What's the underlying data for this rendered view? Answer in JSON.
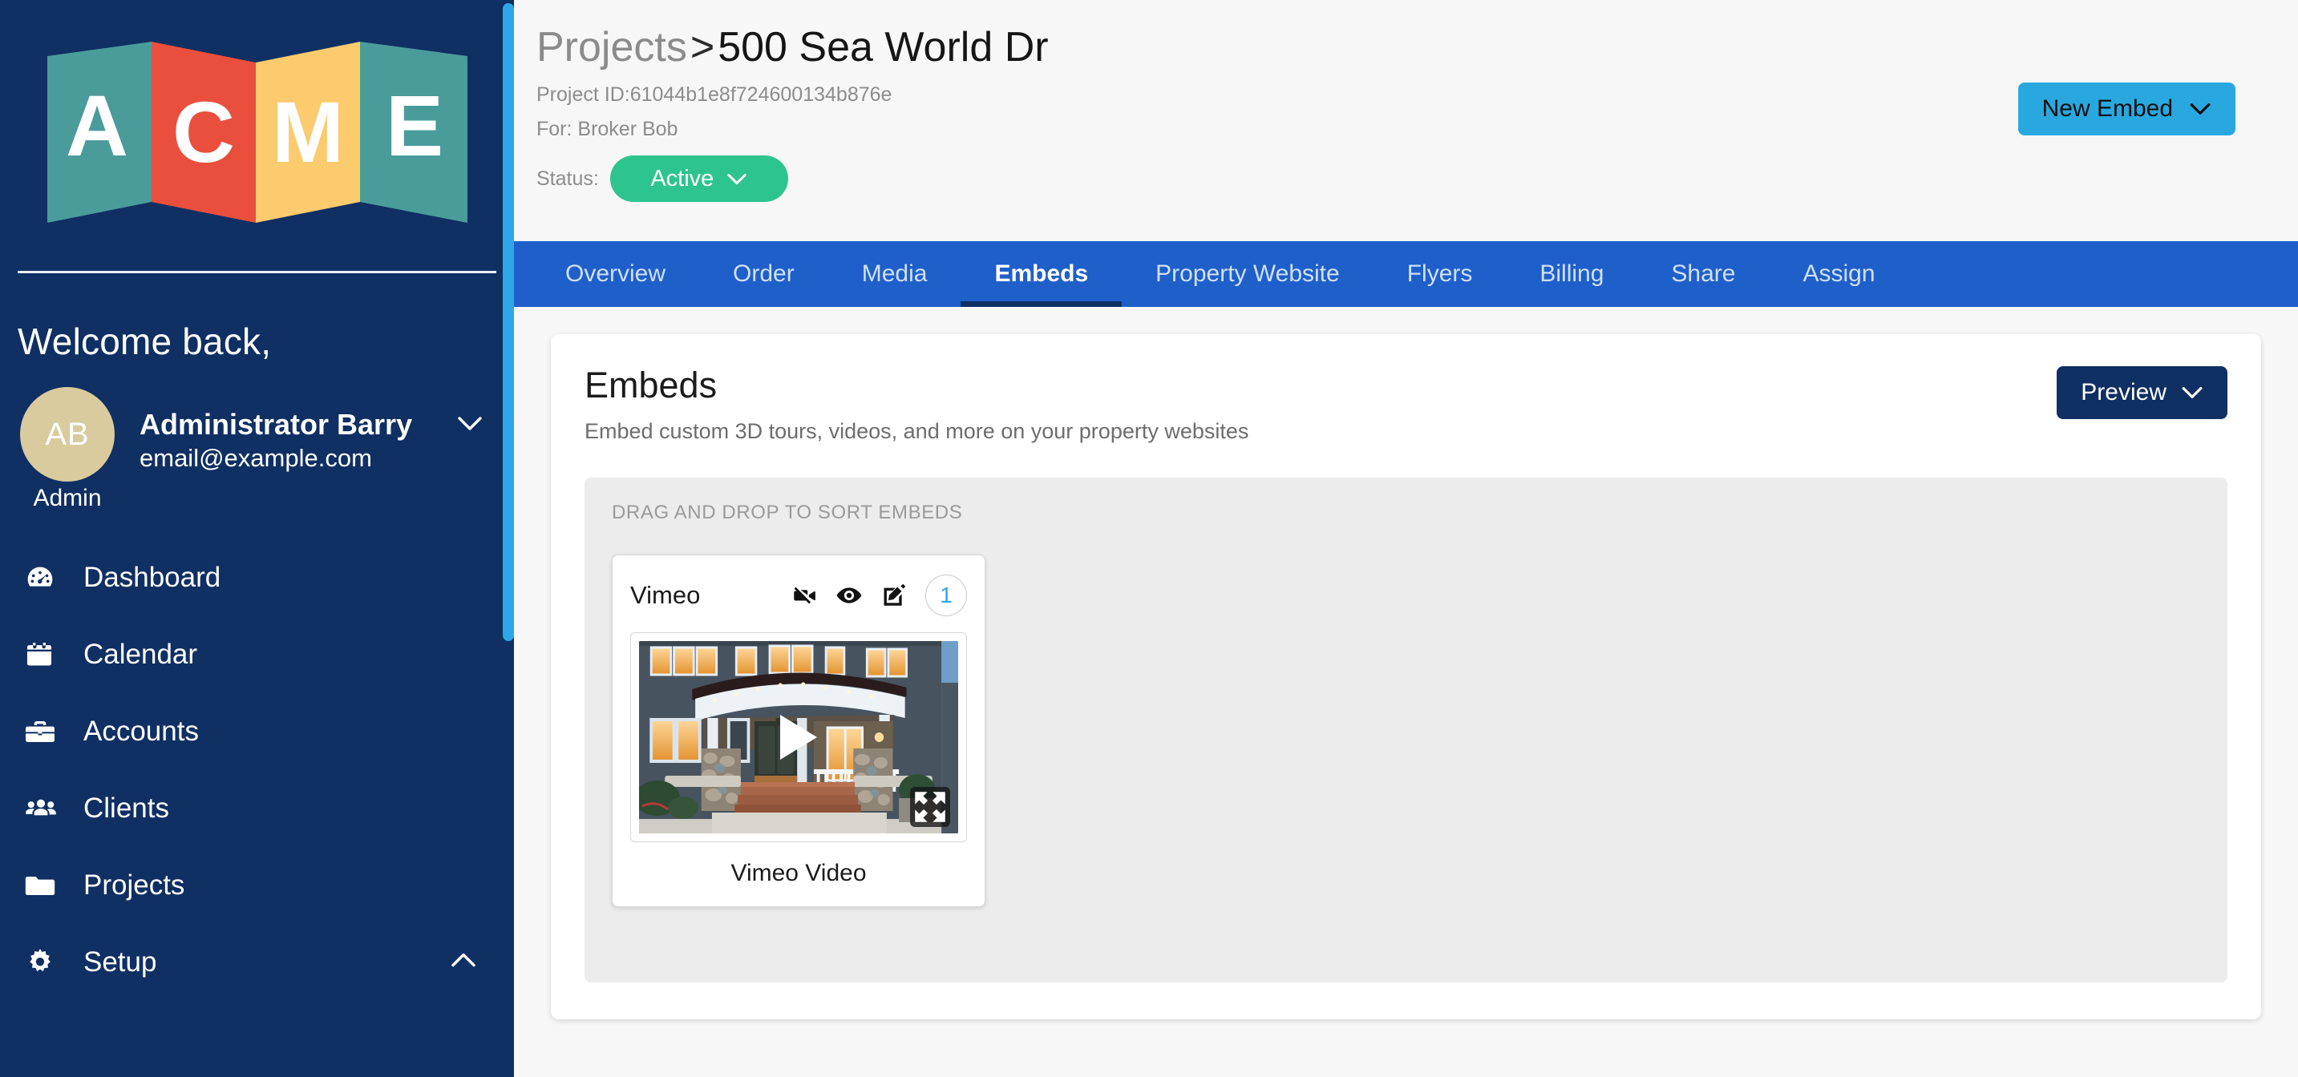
{
  "brand": {
    "logo_text": "ACME",
    "logo_letters": [
      "A",
      "C",
      "M",
      "E"
    ],
    "colors": {
      "sidebar_bg": "#102f63",
      "teal": "#4a9c9a",
      "red": "#ea4f3d",
      "yellow": "#fbcb6e",
      "accent_blue": "#29a8e0",
      "tab_blue": "#1f5fca",
      "status_green": "#2ec48f"
    }
  },
  "sidebar": {
    "welcome_text": "Welcome back,",
    "user": {
      "initials": "AB",
      "role": "Admin",
      "name": "Administrator Barry",
      "email": "email@example.com",
      "chevron": "chevron-down-icon"
    },
    "items": [
      {
        "label": "Dashboard",
        "icon": "tachometer-icon"
      },
      {
        "label": "Calendar",
        "icon": "calendar-icon"
      },
      {
        "label": "Accounts",
        "icon": "briefcase-icon"
      },
      {
        "label": "Clients",
        "icon": "users-icon"
      },
      {
        "label": "Projects",
        "icon": "folder-icon"
      },
      {
        "label": "Setup",
        "icon": "gear-icon",
        "chevron": "chevron-up-icon"
      }
    ]
  },
  "header": {
    "breadcrumb_parent": "Projects",
    "breadcrumb_separator": ">",
    "breadcrumb_current": "500 Sea World Dr",
    "project_id_line": "Project ID:61044b1e8f724600134b876e",
    "for_line": "For: Broker Bob",
    "status_label": "Status:",
    "status_value": "Active",
    "new_embed_label": "New Embed"
  },
  "tabs": [
    {
      "label": "Overview",
      "active": false
    },
    {
      "label": "Order",
      "active": false
    },
    {
      "label": "Media",
      "active": false
    },
    {
      "label": "Embeds",
      "active": true
    },
    {
      "label": "Property Website",
      "active": false
    },
    {
      "label": "Flyers",
      "active": false
    },
    {
      "label": "Billing",
      "active": false
    },
    {
      "label": "Share",
      "active": false
    },
    {
      "label": "Assign",
      "active": false
    }
  ],
  "panel": {
    "title": "Embeds",
    "subtitle": "Embed custom 3D tours, videos, and more on your property websites",
    "preview_label": "Preview",
    "drop_hint": "DRAG AND DROP TO SORT EMBEDS",
    "embeds": [
      {
        "name": "Vimeo",
        "caption": "Vimeo Video",
        "badge_count": "1",
        "actions": [
          "video-slash-icon",
          "eye-icon",
          "edit-pencil-icon"
        ],
        "thumbnail_alt": "Exterior of a craftsman home at dusk with lit windows and a stone porch",
        "has_play_button": true,
        "has_fullscreen_button": true
      }
    ]
  }
}
